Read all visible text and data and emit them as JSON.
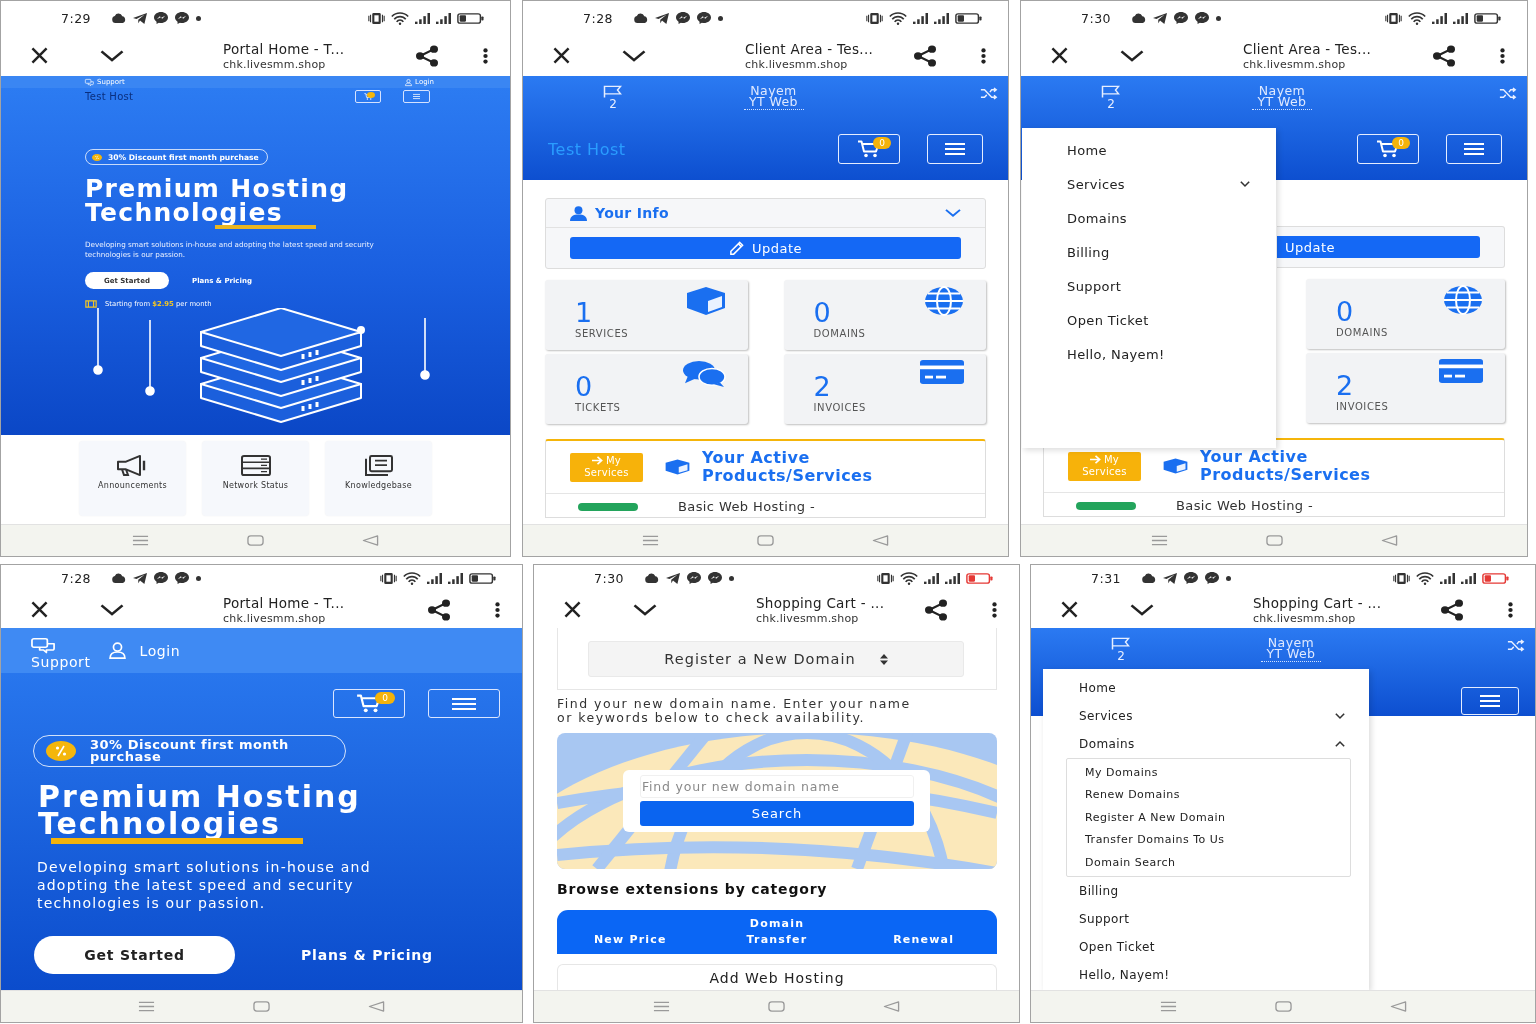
{
  "rows": [
    {
      "panels": [
        {
          "kind": "portal_home_wide",
          "status_bar": {
            "time": "7:29",
            "battery_low": false
          },
          "browser": {
            "title": "Portal Home - T...",
            "url": "chk.livesmm.shop"
          },
          "page": {
            "support": "Support",
            "login": "Login",
            "brand": "Test Host",
            "promo": "30% Discount first month purchase",
            "heading": "Premium Hosting Technologies",
            "text": "Developing smart solutions in-house and adopting the latest speed and security technologies is our passion.",
            "primary_button": "Get Started",
            "secondary_link": "Plans & Pricing",
            "starting": "Starting from **$2.95** per month",
            "features": [
              {
                "kind": "announcements",
                "label": "Announcements"
              },
              {
                "kind": "network",
                "label": "Network Status"
              },
              {
                "kind": "knowledgebase",
                "label": "Knowledgebase"
              }
            ]
          }
        },
        {
          "kind": "client_area",
          "status_bar": {
            "time": "7:28",
            "battery_low": false
          },
          "browser": {
            "title": "Client Area - Tes...",
            "url": "chk.livesmm.shop"
          },
          "page": {
            "notifications": "2",
            "account": "Nayem YT Web",
            "brand": "Test Host",
            "cart_count": "0",
            "info": {
              "title": "Your Info",
              "button": "Update"
            },
            "tiles": [
              {
                "kind": "services",
                "value": "1",
                "label": "SERVICES"
              },
              {
                "kind": "domains",
                "value": "0",
                "label": "DOMAINS"
              },
              {
                "kind": "tickets",
                "value": "0",
                "label": "TICKETS"
              },
              {
                "kind": "invoices",
                "value": "2",
                "label": "INVOICES"
              }
            ],
            "products": {
              "button": "My Services",
              "title": "Your Active Products/Services",
              "row": "Basic Web Hosting -"
            }
          }
        },
        {
          "kind": "client_area",
          "status_bar": {
            "time": "7:30",
            "battery_low": false
          },
          "browser": {
            "title": "Client Area - Tes...",
            "url": "chk.livesmm.shop"
          },
          "page": {
            "notifications": "2",
            "account": "Nayem YT Web",
            "cart_count": "0",
            "menu": {
              "items": [
                {
                  "label": "Home"
                },
                {
                  "label": "Services",
                  "expanded": false
                },
                {
                  "label": "Domains"
                },
                {
                  "label": "Billing"
                },
                {
                  "label": "Support"
                },
                {
                  "label": "Open Ticket"
                },
                {
                  "label": "Hello, Nayem!"
                }
              ]
            },
            "info": {
              "button": "Update"
            },
            "tiles": [
              {
                "kind": "domains",
                "value": "0",
                "label": "DOMAINS"
              },
              {
                "kind": "invoices",
                "value": "2",
                "label": "INVOICES"
              }
            ],
            "products": {
              "button": "My Services",
              "title": "Your Active Products/Services",
              "row": "Basic Web Hosting -"
            }
          }
        }
      ]
    },
    {
      "panels": [
        {
          "kind": "portal_home",
          "status_bar": {
            "time": "7:28",
            "battery_low": false
          },
          "browser": {
            "title": "Portal Home - T...",
            "url": "chk.livesmm.shop"
          },
          "page": {
            "support": "Support",
            "login": "Login",
            "cart_count": "0",
            "promo": "30% Discount first month purchase",
            "heading": "Premium Hosting Technologies",
            "text": "Developing smart solutions in-house and adopting the latest speed and security technologies is our passion.",
            "primary_button": "Get Started",
            "secondary_link": "Plans & Pricing"
          }
        },
        {
          "kind": "domain_search",
          "status_bar": {
            "time": "7:30",
            "battery_low": true
          },
          "browser": {
            "title": "Shopping Cart - ...",
            "url": "chk.livesmm.shop"
          },
          "page": {
            "select": "Register a New Domain",
            "text": "Find your new domain name. Enter your name or keywords below to check availability.",
            "search": {
              "placeholder": "Find your new domain name",
              "button": "Search"
            },
            "heading": "Browse extensions by category",
            "columns": [
              "New Price",
              "Domain Transfer",
              "Renewal"
            ],
            "card": "Add Web Hosting"
          }
        },
        {
          "kind": "cart_menu",
          "status_bar": {
            "time": "7:31",
            "battery_low": true
          },
          "browser": {
            "title": "Shopping Cart - ...",
            "url": "chk.livesmm.shop"
          },
          "page": {
            "notifications": "2",
            "account": "Nayem YT Web",
            "menu": {
              "items": [
                {
                  "label": "Home"
                },
                {
                  "label": "Services",
                  "expanded": false
                },
                {
                  "label": "Domains",
                  "expanded": true,
                  "children": [
                    {
                      "label": "My Domains"
                    },
                    {
                      "label": "Renew Domains"
                    },
                    {
                      "label": "Register A New Domain"
                    },
                    {
                      "label": "Transfer Domains To Us"
                    },
                    {
                      "label": "Domain Search"
                    }
                  ]
                },
                {
                  "label": "Billing"
                },
                {
                  "label": "Support"
                },
                {
                  "label": "Open Ticket"
                },
                {
                  "label": "Hello, Nayem!"
                }
              ]
            }
          }
        }
      ]
    }
  ]
}
